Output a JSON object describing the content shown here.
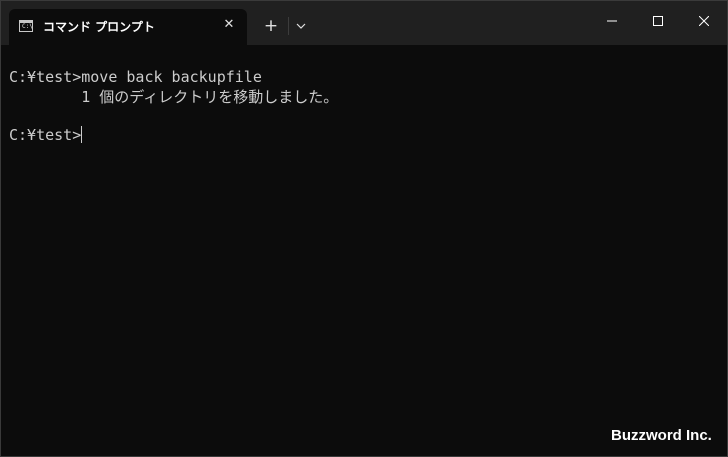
{
  "tab": {
    "title": "コマンド プロンプト",
    "icon_text": "C:\\",
    "close_symbol": "✕"
  },
  "toolbar": {
    "new_tab_symbol": "+"
  },
  "window_controls": [
    "minimize",
    "maximize",
    "close"
  ],
  "terminal": {
    "lines": [
      "C:¥test>move back backupfile",
      "        1 個のディレクトリを移動しました。",
      "C:¥test>"
    ]
  },
  "watermark": "Buzzword Inc.",
  "colors": {
    "titlebar": "#202020",
    "background": "#0c0c0c",
    "text": "#cccccc"
  }
}
